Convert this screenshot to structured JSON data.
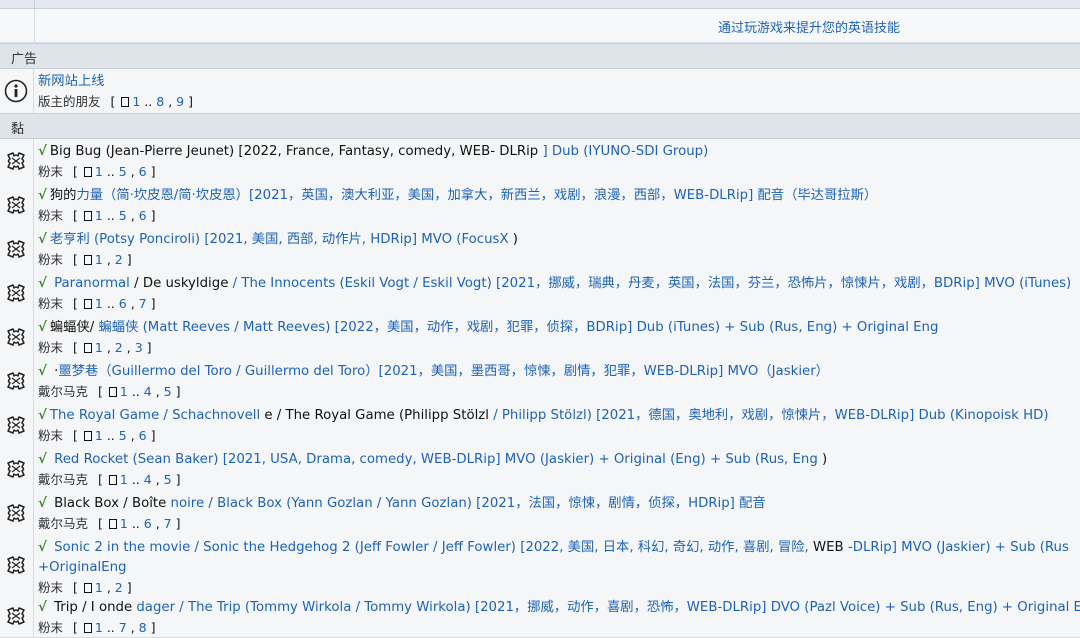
{
  "promo": {
    "text": "通过玩游戏来提升您的英语技能"
  },
  "sections": {
    "ads": "广告",
    "sticky": "黏"
  },
  "announcement": {
    "title": "新网站上线",
    "author": "版主的朋友",
    "pages": [
      "1",
      "..",
      "8",
      ",",
      "9"
    ]
  },
  "rows": [
    {
      "pre_black": "Big Bug (Jean-Pierre Jeunet) [2022, France, Fantasy, comedy, WEB- DLRip",
      "link": " ] Dub (IYUNO-SDI Group)",
      "post_black": "",
      "link2": "",
      "author": "粉末",
      "pages": [
        "1",
        "..",
        "5",
        ",",
        "6"
      ]
    },
    {
      "pre_black": "狗的",
      "link": "力量（简·坎皮恩/简·坎皮恩）[2021，英国，澳大利亚，美国，加拿大，新西兰，戏剧，浪漫，西部，WEB-DLRip] 配音（毕达哥拉斯）",
      "post_black": "",
      "link2": "",
      "author": "粉末",
      "pages": [
        "1",
        "..",
        "5",
        ",",
        "6"
      ]
    },
    {
      "pre_black": "",
      "link": "老亨利 (Potsy Ponciroli) [2021, 美国, 西部, 动作片, HDRip] MVO (FocusX",
      "post_black": " )",
      "link2": "",
      "author": "粉末",
      "pages": [
        "1",
        ",",
        "2"
      ]
    },
    {
      "pre_black": "",
      "link": " Paranormal",
      "post_black": " / De uskyldige ",
      "link2": "/ The Innocents (Eskil Vogt / Eskil Vogt) [2021，挪威，瑞典，丹麦，英国，法国，芬兰，恐怖片，惊悚片，戏剧，BDRip] MVO (iTunes)",
      "author": "粉末",
      "pages": [
        "1",
        "..",
        "6",
        ",",
        "7"
      ]
    },
    {
      "pre_black": "蝙蝠侠/ ",
      "link": "蝙蝠侠 (Matt Reeves / Matt Reeves) [2022，美国，动作，戏剧，犯罪，侦探，BDRip] Dub (iTunes) + Sub (Rus, Eng) + Original Eng",
      "post_black": "",
      "link2": "",
      "author": "粉末",
      "pages": [
        "1",
        ",",
        "2",
        ",",
        "3"
      ]
    },
    {
      "pre_black": " ·",
      "link": "噩梦巷（Guillermo del Toro / Guillermo del Toro）[2021，美国，墨西哥，惊悚，剧情，犯罪，WEB-DLRip] MVO（Jaskier）",
      "post_black": "",
      "link2": "",
      "author": "戴尔马克",
      "pages": [
        "1",
        "..",
        "4",
        ",",
        "5"
      ]
    },
    {
      "pre_black": "",
      "link": "The  Royal Game / Schachnovell",
      "post_black": " e / The Royal Game (Philipp Stölzl ",
      "link2": "/ Philipp Stölzl) [2021，德国，奥地利，戏剧，惊悚片，WEB-DLRip] Dub (Kinopoisk HD)",
      "author": "粉末",
      "pages": [
        "1",
        "..",
        "5",
        ",",
        "6"
      ]
    },
    {
      "pre_black": "",
      "link": " Red Rocket (Sean Baker) [2021, USA, Drama, comedy, WEB-DLRip] MVO (Jaskier) + Original (Eng) + Sub (Rus, Eng",
      "post_black": " )",
      "link2": "",
      "author": "戴尔马克",
      "pages": [
        "1",
        "..",
        "4",
        ",",
        "5"
      ]
    },
    {
      "pre_black": " Black Box / Boîte",
      "link": " noire / Black Box (Yann Gozlan / Yann Gozlan) [2021，法国，惊悚，剧情，侦探，HDRip] 配音",
      "post_black": "",
      "link2": "",
      "author": "戴尔马克",
      "pages": [
        "1",
        "..",
        "6",
        ",",
        "7"
      ]
    },
    {
      "pre_black": "",
      "link": " Sonic 2 in the movie / Sonic the Hedgehog 2 (Jeff Fowler / Jeff Fowler) [2022, 美国, 日本, 科幻, 奇幻, 动作, 喜剧, 冒险,",
      "post_black": " WEB ",
      "link2": "-DLRip] MVO (Jaskier) + Sub (Rus",
      "wrap": "+OriginalEng",
      "author": "粉末",
      "pages": [
        "1",
        ",",
        "2"
      ]
    },
    {
      "pre_black": " Trip / I onde",
      "link": " dager / The Trip (Tommy Wirkola / Tommy Wirkola) [2021，挪威，动作，喜剧，恐怖，WEB-DLRip] DVO (Pazl Voice) + Sub (Rus, Eng) + Original En",
      "post_black": "",
      "link2": "",
      "author": "粉末",
      "pages": [
        "1",
        "..",
        "7",
        ",",
        "8"
      ]
    }
  ]
}
